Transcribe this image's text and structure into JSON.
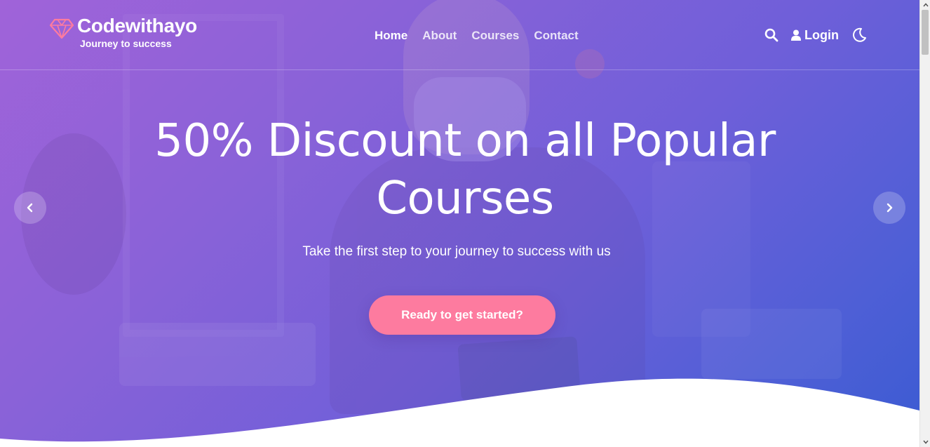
{
  "brand": {
    "name": "Codewithayo",
    "tagline": "Journey to success",
    "logo_icon": "diamond-icon",
    "logo_color": "#fd7b9f"
  },
  "nav": {
    "items": [
      {
        "label": "Home",
        "active": true
      },
      {
        "label": "About",
        "active": false
      },
      {
        "label": "Courses",
        "active": false
      },
      {
        "label": "Contact",
        "active": false
      }
    ]
  },
  "header_actions": {
    "search_icon": "search-icon",
    "login_label": "Login",
    "login_icon": "user-icon",
    "theme_icon": "moon-icon"
  },
  "hero": {
    "title": "50% Discount on all Popular Courses",
    "subtitle": "Take the first step to your journey to success with us",
    "cta_label": "Ready to get started?",
    "prev_icon": "chevron-left-icon",
    "next_icon": "chevron-right-icon"
  },
  "colors": {
    "gradient_start": "#a063d9",
    "gradient_end": "#3b5bd2",
    "cta": "#fd7b9f",
    "text": "#ffffff"
  }
}
